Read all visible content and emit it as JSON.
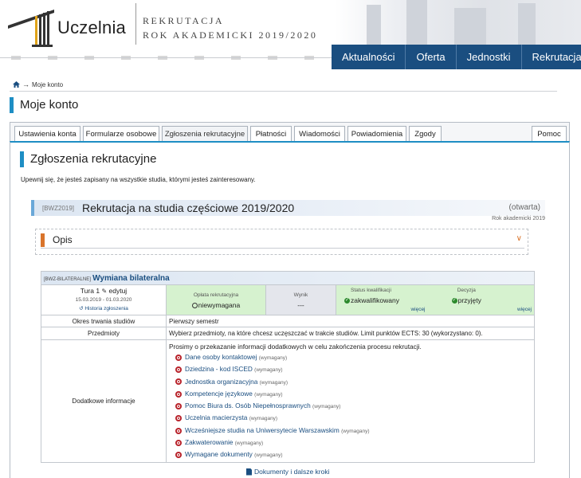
{
  "header": {
    "logo_text": "Uczelnia",
    "title_line1": "REKRUTACJA",
    "title_line2": "ROK AKADEMICKI 2019/2020",
    "nav": [
      "Aktualności",
      "Oferta",
      "Jednostki",
      "Rekrutacja"
    ]
  },
  "breadcrumb": {
    "current": "Moje konto"
  },
  "page_title": "Moje konto",
  "tabs": [
    "Ustawienia konta",
    "Formularze osobowe",
    "Zgłoszenia rekrutacyjne",
    "Płatności",
    "Wiadomości",
    "Powiadomienia",
    "Zgody",
    "Pomoc"
  ],
  "active_tab": "Zgłoszenia rekrutacyjne",
  "section": {
    "title": "Zgłoszenia rekrutacyjne",
    "intro": "Upewnij się, że jesteś zapisany na wszystkie studia, którymi jesteś zainteresowany."
  },
  "recruitment": {
    "code": "[BWZ2019]",
    "title": "Rekrutacja na studia częściowe 2019/2020",
    "status": "(otwarta)",
    "year": "Rok akademicki 2019",
    "opis_label": "Opis"
  },
  "exchange": {
    "code": "[BWZ-BILATERALNE]",
    "name": "Wymiana bilateralna",
    "round": {
      "label": "Tura 1",
      "edit_label": "edytuj",
      "dates": "15.03.2019 - 01.03.2020",
      "history_label": "Historia zgłoszenia"
    },
    "fee": {
      "label": "Opłata rekrutacyjna",
      "value": "niewymagana"
    },
    "result": {
      "label": "Wynik",
      "value": "---"
    },
    "qualification": {
      "label": "Status kwalifikacji",
      "value": "zakwalifikowany",
      "more": "więcej"
    },
    "decision": {
      "label": "Decyzja",
      "value": "przyjęty",
      "more": "więcej"
    },
    "rows": {
      "duration": {
        "label": "Okres trwania studiów",
        "value": "Pierwszy semestr"
      },
      "subjects": {
        "label": "Przedmioty",
        "value": "Wybierz przedmioty, na które chcesz uczęszczać w trakcie studiów. Limit punktów ECTS: 30 (wykorzystano: 0)."
      },
      "additional": {
        "label": "Dodatkowe informacje",
        "intro": "Prosimy o przekazanie informacji dodatkowych w celu zakończenia procesu rekrutacji.",
        "required_tag": "(wymagany)",
        "items": [
          "Dane osoby kontaktowej",
          "Dziedzina - kod ISCED",
          "Jednostka organizacyjna",
          "Kompetencje językowe",
          "Pomoc Biura ds. Osób Niepełnosprawnych",
          "Uczelnia macierzysta",
          "Wcześniejsze studia na Uniwersytecie Warszawskim",
          "Zakwaterowanie",
          "Wymagane dokumenty"
        ]
      }
    },
    "docs_link": "Dokumenty i dalsze kroki"
  },
  "colors": {
    "accent": "#1e8ec4",
    "nav": "#1a4e80",
    "green": "#d6f2cf",
    "orange": "#d9742b"
  }
}
